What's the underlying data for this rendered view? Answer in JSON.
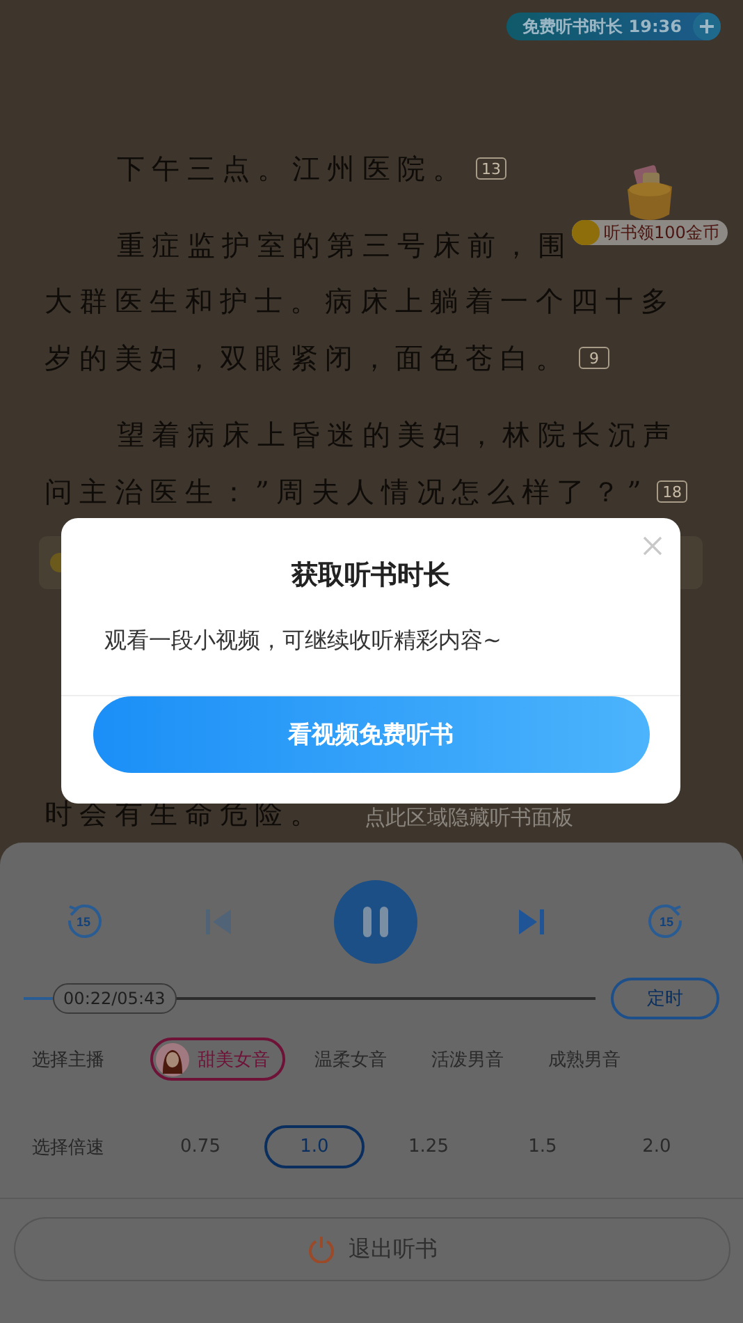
{
  "status_pill": {
    "label": "免费听书时长 19:36"
  },
  "coin_badge": {
    "label": "听书领100金币"
  },
  "reader": {
    "lines": [
      {
        "kind": "full",
        "indent": true,
        "text": "下午三点。江州医院。",
        "comment_count": "13"
      },
      {
        "kind": "full",
        "indent": true,
        "text": "重症监护室的第三号床前，围"
      },
      {
        "kind": "full",
        "indent": false,
        "text": "大群医生和护士。病床上躺着一个四十多"
      },
      {
        "kind": "full",
        "indent": false,
        "text": "岁的美妇，双眼紧闭，面色苍白。",
        "comment_count": "9"
      },
      {
        "kind": "full",
        "indent": true,
        "text": "望着病床上昏迷的美妇，林院长沉声"
      },
      {
        "kind": "full",
        "indent": false,
        "text": "问主治医生：”周夫人情况怎么样了？”",
        "comment_count": "18"
      },
      {
        "kind": "banner"
      },
      {
        "kind": "full",
        "indent": false,
        "text": "时会有生命危险。"
      }
    ]
  },
  "hide_hint": "点此区域隐藏听书面板",
  "dialog": {
    "title": "获取听书时长",
    "message": "观看一段小视频，可继续收听精彩内容~",
    "button": "看视频免费听书"
  },
  "player": {
    "rewind_label": "15",
    "forward_label": "15",
    "prev_disabled": true,
    "playing": true,
    "progress": {
      "level": 0.05,
      "time": "00:22/05:43"
    },
    "timer_button": "定时",
    "narrator": {
      "label": "选择主播",
      "options": [
        {
          "label": "甜美女音",
          "selected": true
        },
        {
          "label": "温柔女音",
          "selected": false
        },
        {
          "label": "活泼男音",
          "selected": false
        },
        {
          "label": "成熟男音",
          "selected": false
        }
      ]
    },
    "speed": {
      "label": "选择倍速",
      "options": [
        {
          "label": "0.75",
          "selected": false
        },
        {
          "label": "1.0",
          "selected": true
        },
        {
          "label": "1.25",
          "selected": false
        },
        {
          "label": "1.5",
          "selected": false
        },
        {
          "label": "2.0",
          "selected": false
        }
      ]
    },
    "exit_button": "退出听书"
  }
}
